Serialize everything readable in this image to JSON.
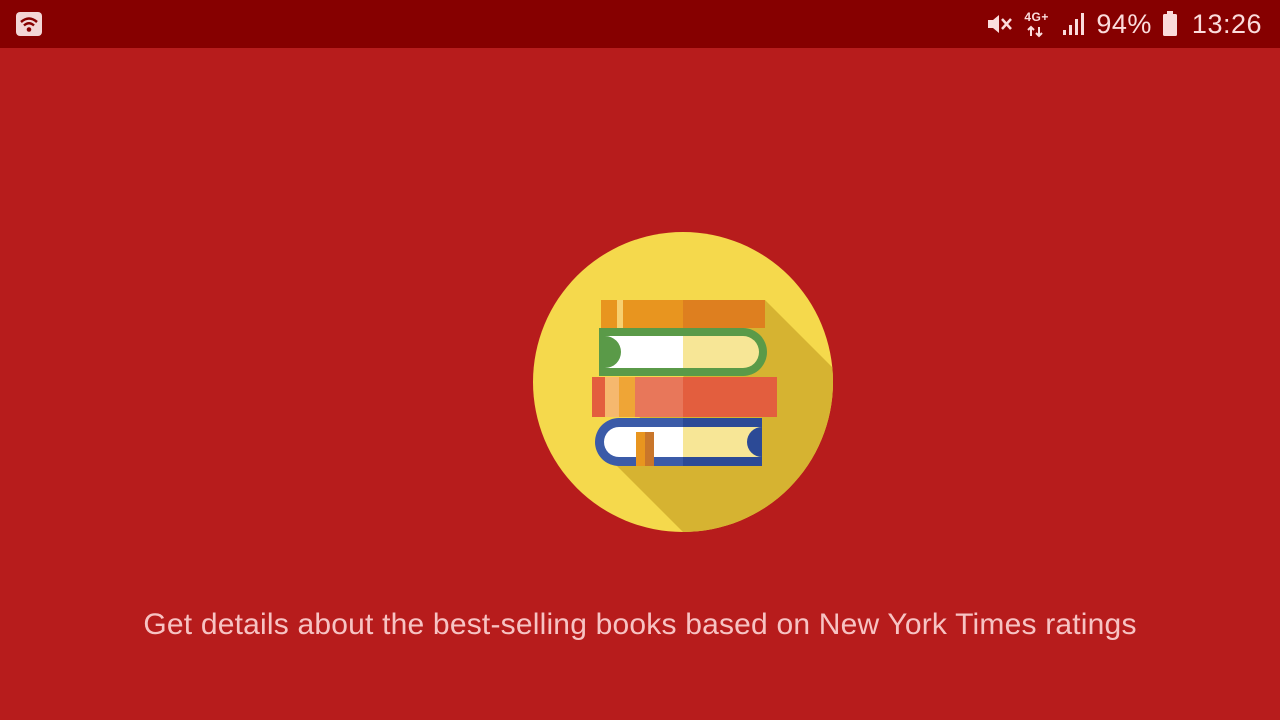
{
  "status_bar": {
    "network_type": "4G+",
    "battery_percent": "94%",
    "time": "13:26",
    "icons": [
      "wifi-icon",
      "mute-icon",
      "network-type-icon",
      "signal-strength-icon",
      "battery-icon"
    ]
  },
  "hero": {
    "icon": "stacked-books-icon"
  },
  "tagline": "Get details about the best-selling books based on New York Times ratings",
  "colors": {
    "background": "#b71c1c",
    "status_bar": "#860000",
    "circle": "#f5d94c",
    "shadow": "#d6b331",
    "tagline": "#f7c3c3"
  }
}
